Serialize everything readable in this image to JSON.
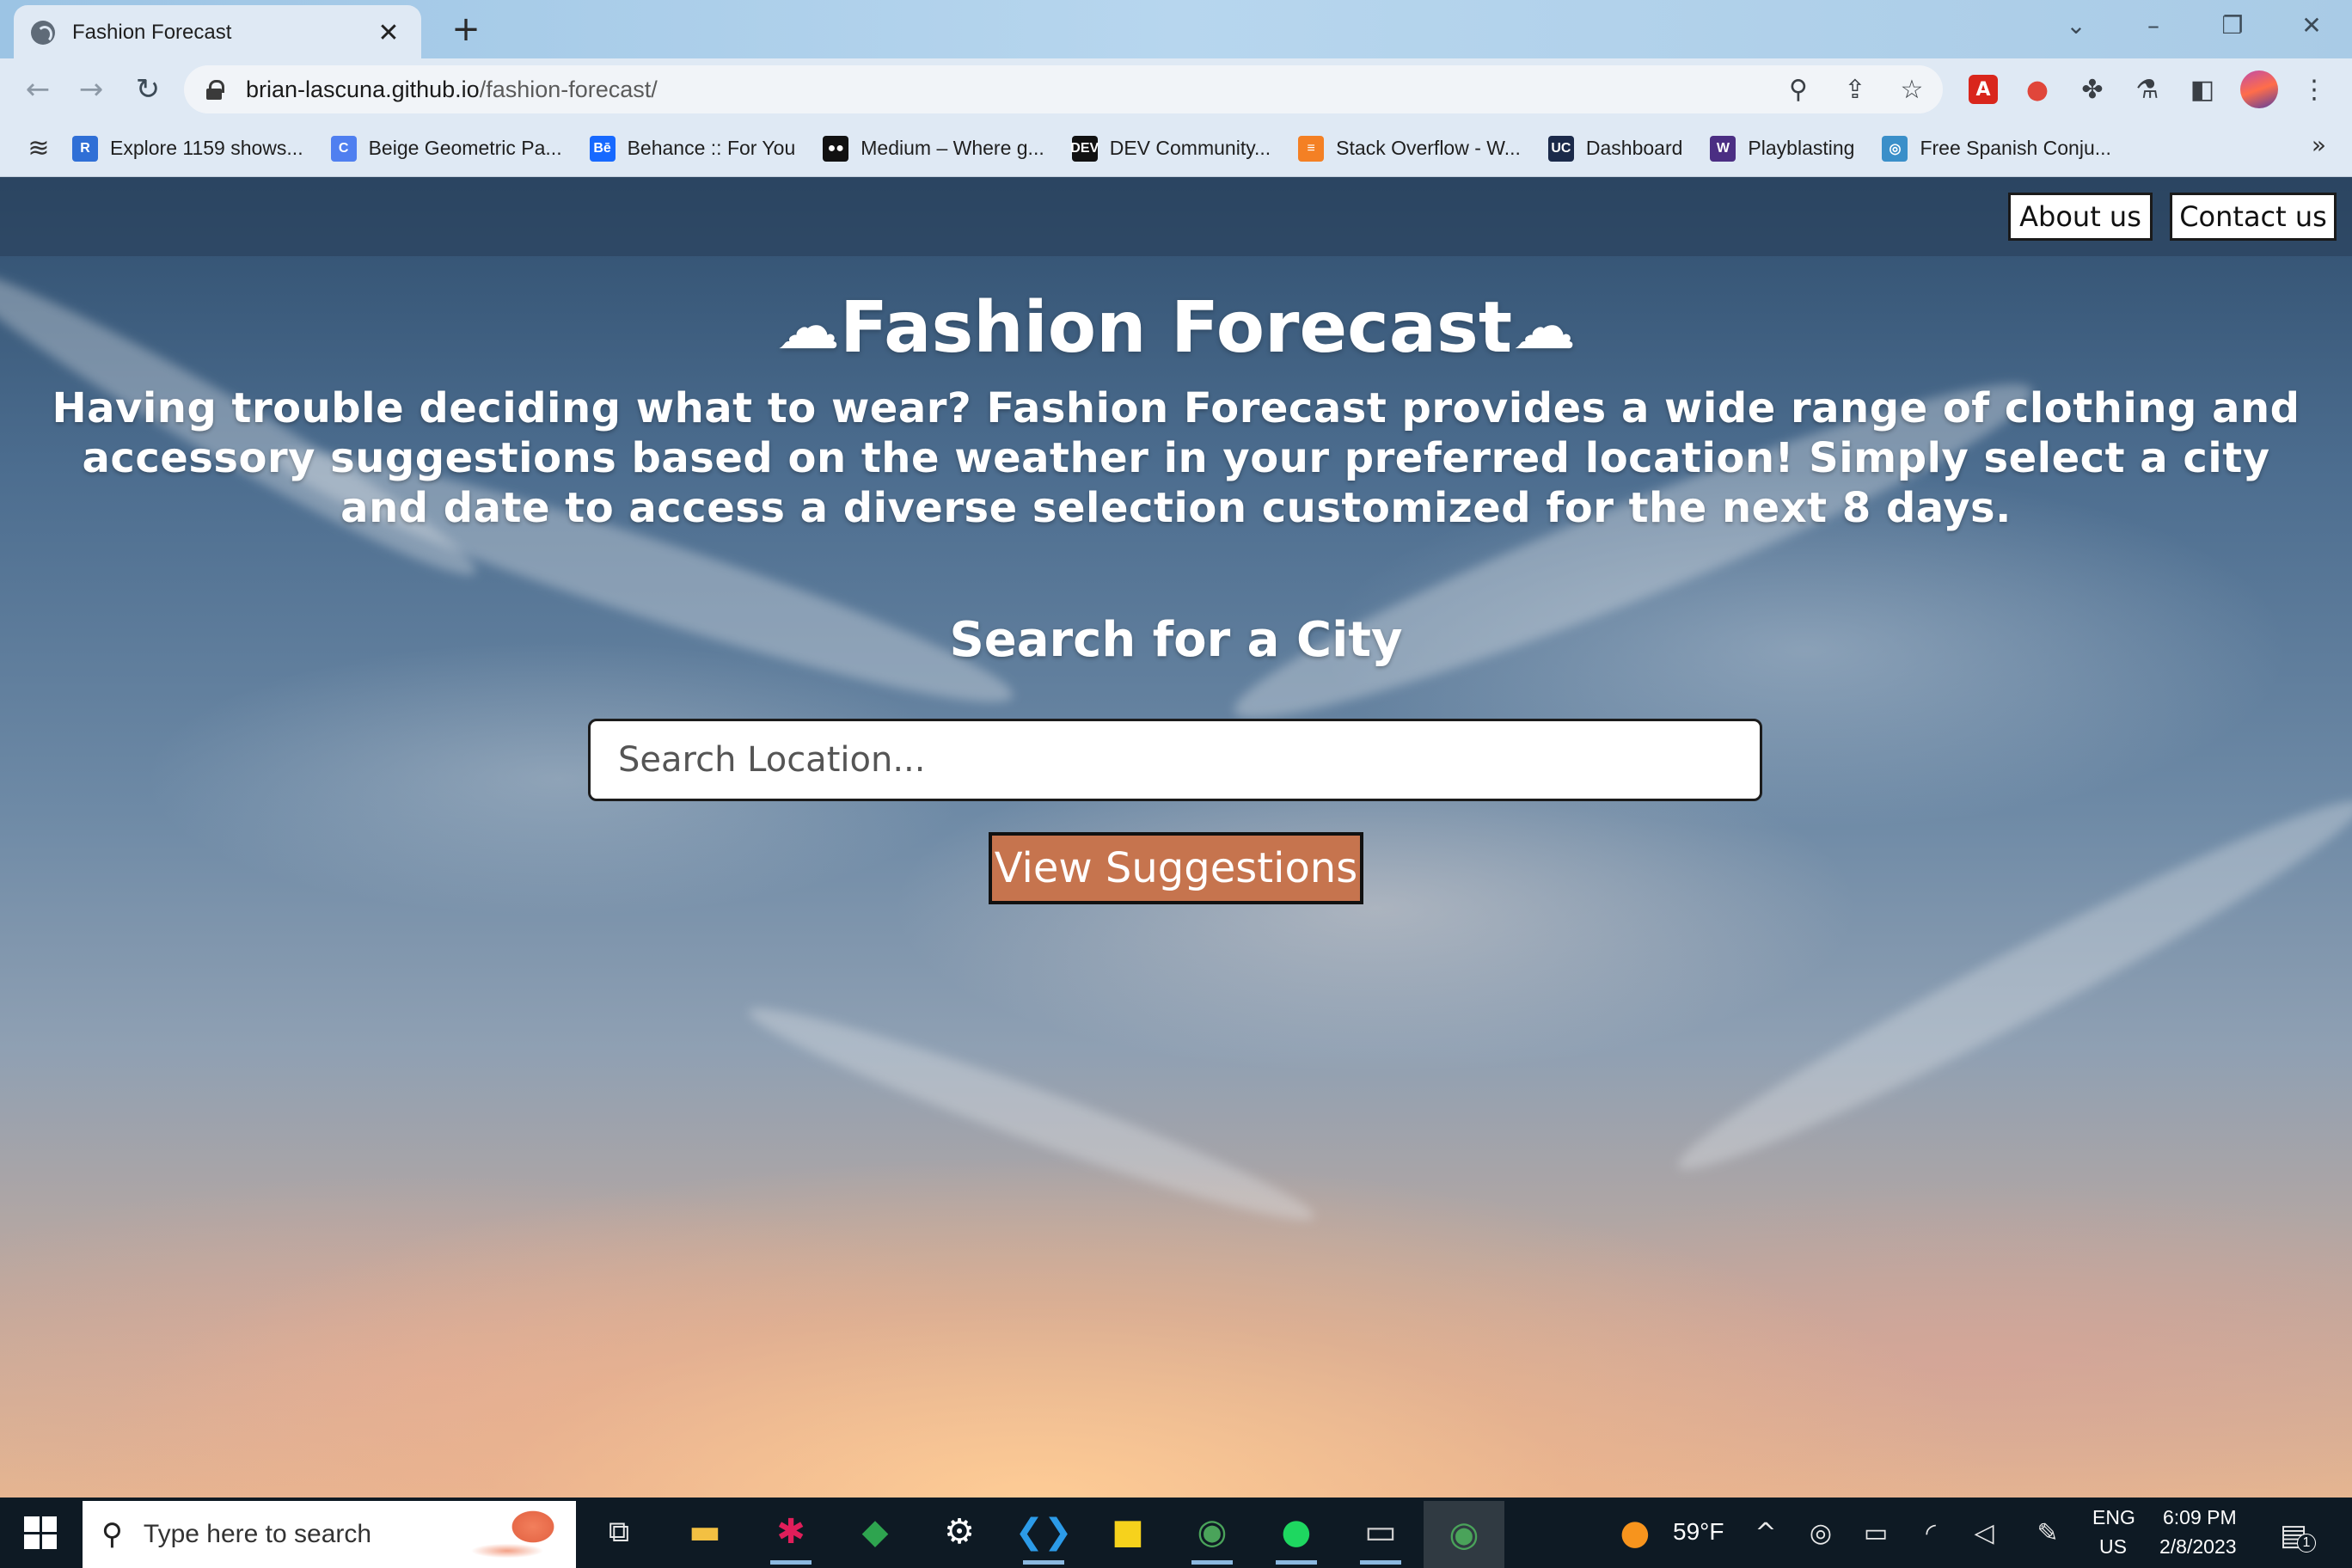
{
  "browser": {
    "tab_title": "Fashion Forecast",
    "url_host": "brian-lascuna.github.io",
    "url_path": "/fashion-forecast/",
    "bookmarks": [
      {
        "label": "Explore 1159 shows...",
        "icon": "R",
        "color": "#2f6fd6"
      },
      {
        "label": "Beige Geometric Pa...",
        "icon": "C",
        "color": "#4f7ff0"
      },
      {
        "label": "Behance :: For You",
        "icon": "Bē",
        "color": "#1769ff"
      },
      {
        "label": "Medium – Where g...",
        "icon": "●●",
        "color": "#111111"
      },
      {
        "label": "DEV Community...",
        "icon": "DEV",
        "color": "#111111"
      },
      {
        "label": "Stack Overflow - W...",
        "icon": "≡",
        "color": "#f48024"
      },
      {
        "label": "Dashboard",
        "icon": "UC",
        "color": "#1b2a4a"
      },
      {
        "label": "Playblasting",
        "icon": "W",
        "color": "#4b2e83"
      },
      {
        "label": "Free Spanish Conju...",
        "icon": "◎",
        "color": "#3a8fc9"
      }
    ]
  },
  "page": {
    "nav": {
      "about": "About us",
      "contact": "Contact us"
    },
    "title": "Fashion Forecast",
    "cloud_glyph": "☁",
    "description": "Having trouble deciding what to wear? Fashion Forecast provides a wide range of clothing and accessory suggestions based on the weather in your preferred location! Simply select a city and date to access a diverse selection customized for the next 8 days.",
    "search_heading": "Search for a City",
    "search_placeholder": "Search Location...",
    "button_label": "View Suggestions"
  },
  "taskbar": {
    "search_placeholder": "Type here to search",
    "weather": "59°F",
    "language": "ENG",
    "region": "US",
    "time": "6:09 PM",
    "date": "2/8/2023",
    "notifications": "1"
  }
}
